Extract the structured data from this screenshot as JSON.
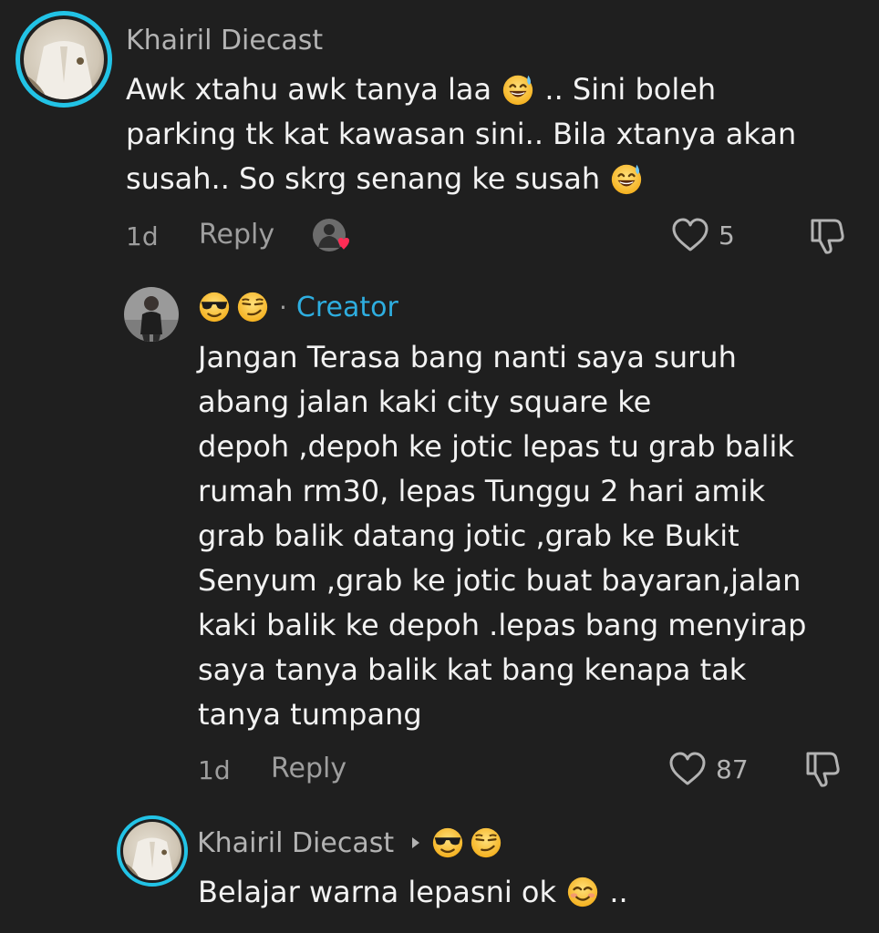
{
  "comments": [
    {
      "username": "Khairil Diecast",
      "body_lines": [
        "Awk xtahu awk tanya laa",
        ".. Sini boleh",
        "parking tk kat kawasan sini.. Bila xtanya akan",
        "susah.. So skrg senang ke susah"
      ],
      "time": "1d",
      "reply_label": "Reply",
      "likes": "5"
    },
    {
      "username_emojis": [
        "sunglasses-emoji",
        "smirk-emoji"
      ],
      "separator": "·",
      "badge": "Creator",
      "body_lines": [
        "Jangan Terasa bang nanti saya suruh",
        "abang jalan kaki city square ke",
        "depoh ,depoh ke jotic lepas tu grab balik",
        "rumah rm30, lepas Tunggu 2 hari amik",
        "grab balik datang jotic ,grab ke Bukit",
        "Senyum ,grab ke jotic buat bayaran,jalan",
        "kaki balik ke depoh .lepas bang menyirap",
        "saya tanya balik kat bang kenapa tak",
        "tanya tumpang"
      ],
      "time": "1d",
      "reply_label": "Reply",
      "likes": "87"
    },
    {
      "username": "Khairil Diecast",
      "reply_to_emojis": [
        "sunglasses-emoji",
        "smirk-emoji"
      ],
      "body_lines": [
        "Belajar warna lepasni ok",
        ".."
      ]
    }
  ],
  "colors": {
    "background": "#1f1f1f",
    "story_ring": "#22c3e6",
    "creator_badge": "#2eaee0",
    "like_heart": "#ff2c55"
  }
}
